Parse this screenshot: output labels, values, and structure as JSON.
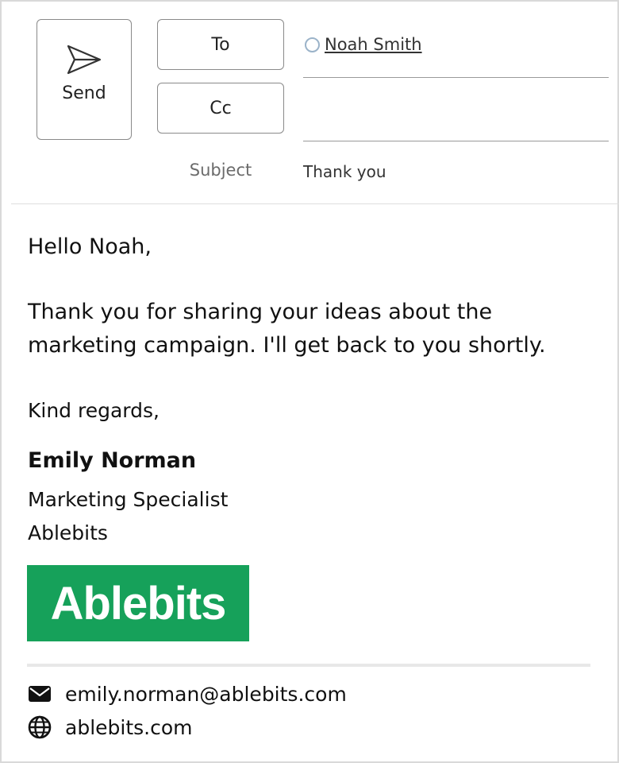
{
  "header": {
    "send_label": "Send",
    "to_label": "To",
    "cc_label": "Cc",
    "subject_label": "Subject",
    "to_recipients": [
      {
        "name": "Noah Smith"
      }
    ],
    "cc_value": "",
    "subject_value": "Thank you"
  },
  "message": {
    "greeting": "Hello Noah,",
    "paragraph": "Thank you for sharing your ideas about the marketing campaign. I'll get back to you shortly.",
    "closing": "Kind regards,"
  },
  "signature": {
    "name": "Emily Norman",
    "title": "Marketing Specialist",
    "company": "Ablebits",
    "logo_text": "Ablebits",
    "logo_color": "#16a15a",
    "email": "emily.norman@ablebits.com",
    "website": "ablebits.com",
    "email_icon": "envelope-icon",
    "website_icon": "globe-icon"
  }
}
